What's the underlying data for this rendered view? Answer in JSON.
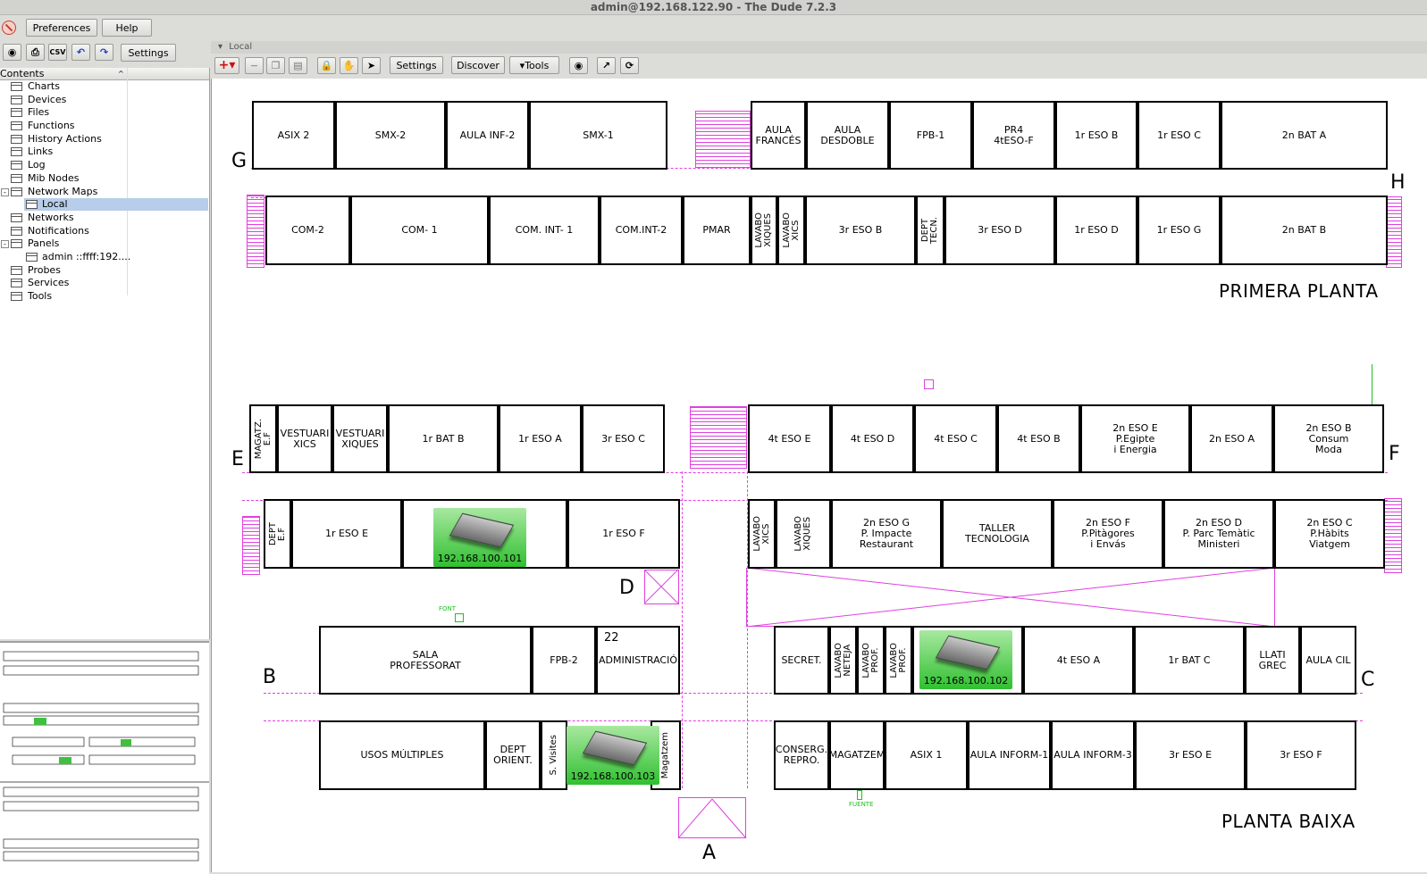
{
  "window": {
    "title": "admin@192.168.122.90 - The Dude 7.2.3"
  },
  "menu": {
    "preferences": "Preferences",
    "help": "Help"
  },
  "left_toolbar": {
    "settings": "Settings",
    "csv": "CSV"
  },
  "contents": {
    "header": "Contents",
    "items": [
      {
        "label": "Charts"
      },
      {
        "label": "Devices"
      },
      {
        "label": "Files"
      },
      {
        "label": "Functions"
      },
      {
        "label": "History Actions"
      },
      {
        "label": "Links"
      },
      {
        "label": "Log"
      },
      {
        "label": "Mib Nodes"
      },
      {
        "label": "Network Maps",
        "expanded": "-"
      },
      {
        "label": "Local",
        "selected": true
      },
      {
        "label": "Networks"
      },
      {
        "label": "Notifications"
      },
      {
        "label": "Panels",
        "expanded": "-"
      },
      {
        "label": "admin ::ffff:192...."
      },
      {
        "label": "Probes"
      },
      {
        "label": "Services"
      },
      {
        "label": "Tools"
      }
    ]
  },
  "map": {
    "tab": "Local",
    "toolbar": {
      "settings": "Settings",
      "discover": "Discover",
      "tools": "Tools"
    },
    "floor_labels": {
      "upper": "PRIMERA PLANTA",
      "lower": "PLANTA BAIXA"
    },
    "letters": [
      "G",
      "H",
      "E",
      "F",
      "D",
      "B",
      "C",
      "A"
    ],
    "small_labels": {
      "font": "FONT",
      "fuente": "FUENTE"
    },
    "rooms_upper_top": [
      "ASIX 2",
      "SMX-2",
      "AULA INF-2",
      "SMX-1",
      "AULA\nFRANCÉS",
      "AULA\nDESDOBLE",
      "FPB-1",
      "PR4\n4tESO-F",
      "1r ESO B",
      "1r ESO C",
      "2n BAT A"
    ],
    "rooms_upper_bottom": [
      "COM-2",
      "COM- 1",
      "COM. INT- 1",
      "COM.INT-2",
      "PMAR",
      "LAVABO\nXIQUES",
      "LAVABO\nXICS",
      "3r ESO B",
      "DEPT\nTECN.",
      "3r ESO D",
      "1r ESO D",
      "1r ESO G",
      "2n BAT B"
    ],
    "rooms_lower_top": [
      "MAGATZ.\nE.F",
      "VESTUARI\nXICS",
      "VESTUARI\nXIQUES",
      "1r BAT B",
      "1r ESO A",
      "3r ESO C",
      "4t ESO E",
      "4t ESO D",
      "4t ESO C",
      "4t ESO B",
      "2n ESO E\nP.Egipte\ni Energia",
      "2n ESO A",
      "2n ESO B\nConsum\nModa"
    ],
    "rooms_lower_mid": [
      "DEPT\nE.F",
      "1r ESO E",
      "1r ESO F",
      "LAVABO\nXICS",
      "LAVABO\nXIQUES",
      "2n ESO G\nP. Impacte\nRestaurant",
      "TALLER\nTECNOLOGIA",
      "2n ESO F\nP.Pitàgores\ni Envás",
      "2n ESO D\nP. Parc Temàtic\nMinisteri",
      "2n ESO C\nP.Hàbits\nViatgem"
    ],
    "rooms_block_b": [
      "SALA\nPROFESSORAT",
      "FPB-2",
      "ADMINISTRACIÓ",
      "USOS MÚLTIPLES",
      "DEPT\nORIENT.",
      "S. Visites",
      "Magatzem"
    ],
    "room_number_22": "22",
    "rooms_block_c": [
      "SECRET.",
      "LAVABO\nNETEJA",
      "LAVABO\nPROF.",
      "LAVABO\nPROF.",
      "4t ESO A",
      "1r BAT C",
      "LLATI\nGREC",
      "AULA CIL",
      "CONSERG.\nREPRO.",
      "MAGATZEM",
      "ASIX 1",
      "AULA INFORM-1",
      "AULA INFORM-3",
      "3r ESO E",
      "3r ESO F"
    ],
    "devices": [
      {
        "ip": "192.168.100.101"
      },
      {
        "ip": "192.168.100.102"
      },
      {
        "ip": "192.168.100.103"
      }
    ]
  }
}
